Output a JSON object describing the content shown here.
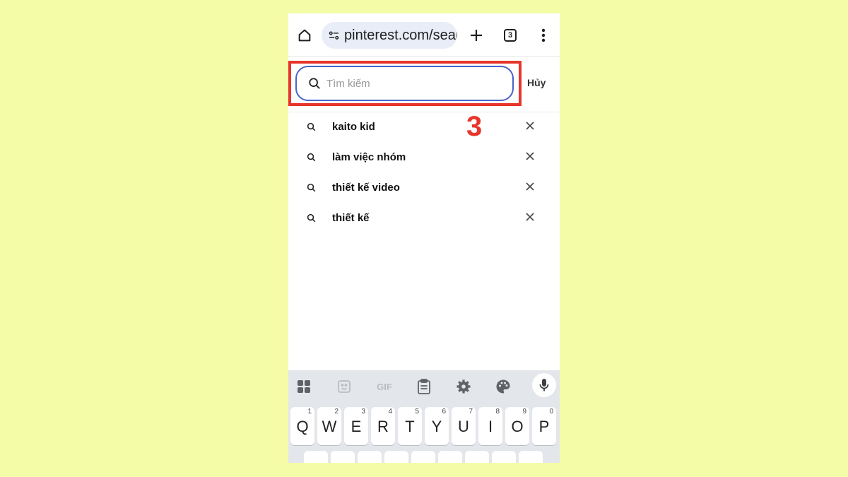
{
  "browser": {
    "url": "pinterest.com/search",
    "tab_count": "3"
  },
  "search": {
    "placeholder": "Tìm kiếm",
    "cancel_label": "Hủy"
  },
  "annotation": {
    "step_number": "3",
    "highlight_color": "#e8352c"
  },
  "suggestions": [
    {
      "label": "kaito kid"
    },
    {
      "label": "làm việc nhóm"
    },
    {
      "label": "thiết kế video"
    },
    {
      "label": "thiết kế"
    }
  ],
  "keyboard": {
    "toolbar": [
      "apps-icon",
      "sticker-icon",
      "GIF",
      "clipboard-icon",
      "settings-icon",
      "palette-icon",
      "mic-icon"
    ],
    "gif_label": "GIF",
    "row1": [
      {
        "letter": "Q",
        "num": "1"
      },
      {
        "letter": "W",
        "num": "2"
      },
      {
        "letter": "E",
        "num": "3"
      },
      {
        "letter": "R",
        "num": "4"
      },
      {
        "letter": "T",
        "num": "5"
      },
      {
        "letter": "Y",
        "num": "6"
      },
      {
        "letter": "U",
        "num": "7"
      },
      {
        "letter": "I",
        "num": "8"
      },
      {
        "letter": "O",
        "num": "9"
      },
      {
        "letter": "P",
        "num": "0"
      }
    ]
  },
  "colors": {
    "background": "#f5fca8",
    "search_border": "#4a64c9",
    "accent_red": "#e8352c"
  }
}
